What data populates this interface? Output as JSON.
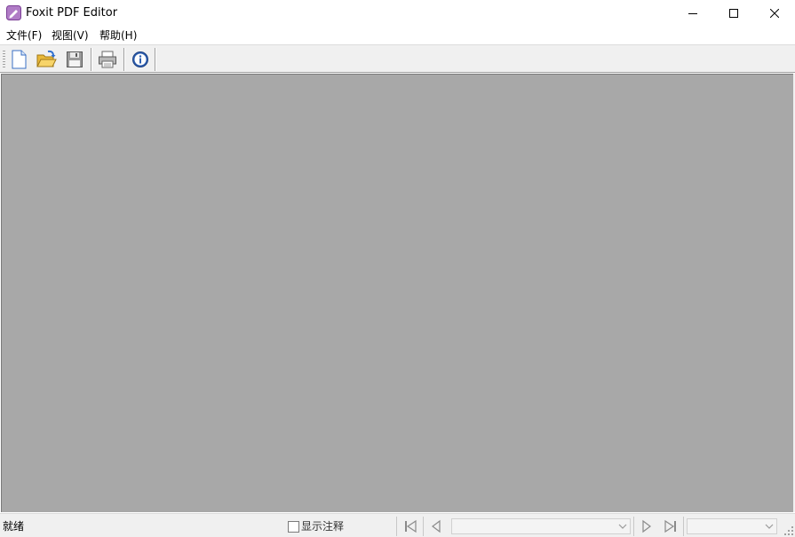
{
  "window": {
    "title": "Foxit PDF Editor",
    "controls": [
      "minimize-icon",
      "maximize-icon",
      "close-icon"
    ]
  },
  "menu": {
    "items": [
      {
        "label": "文件(F)"
      },
      {
        "label": "视图(V)"
      },
      {
        "label": "帮助(H)"
      }
    ]
  },
  "toolbar": {
    "buttons": [
      "new-document-icon",
      "open-folder-icon",
      "save-disk-icon",
      "print-icon",
      "info-icon"
    ]
  },
  "statusbar": {
    "status": "就绪",
    "show_annotations_label": "显示注释",
    "show_annotations_checked": false,
    "page_combo_value": "",
    "zoom_combo_value": ""
  },
  "colors": {
    "workspace": "#a8a8a8",
    "chrome": "#f0f0f0",
    "accent_icon": "#9b59b6"
  }
}
